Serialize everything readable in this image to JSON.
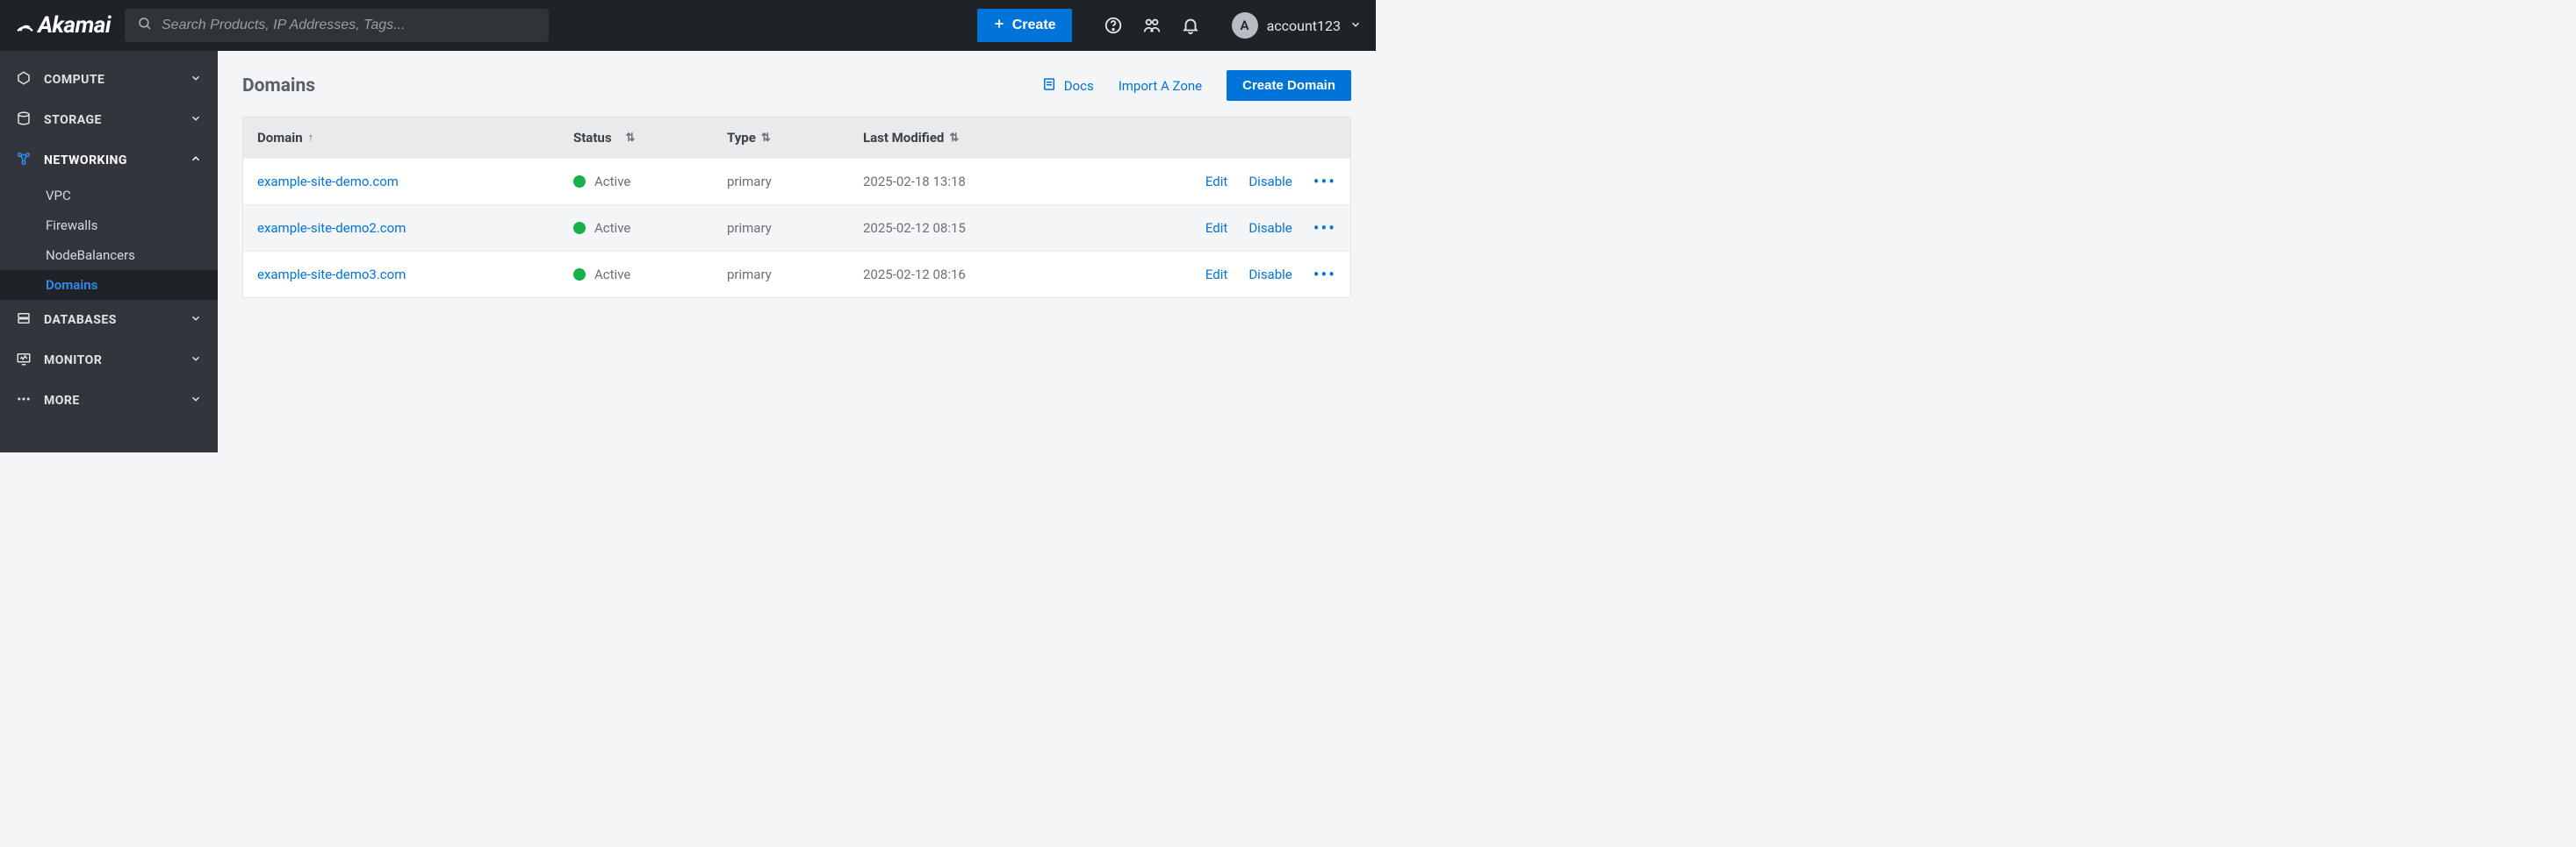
{
  "header": {
    "brand": "Akamai",
    "search_placeholder": "Search Products, IP Addresses, Tags...",
    "create_label": "Create",
    "account_name": "account123",
    "avatar_letter": "A"
  },
  "sidebar": {
    "groups": [
      {
        "label": "COMPUTE",
        "expanded": false
      },
      {
        "label": "STORAGE",
        "expanded": false
      },
      {
        "label": "NETWORKING",
        "expanded": true,
        "items": [
          {
            "label": "VPC",
            "selected": false
          },
          {
            "label": "Firewalls",
            "selected": false
          },
          {
            "label": "NodeBalancers",
            "selected": false
          },
          {
            "label": "Domains",
            "selected": true
          }
        ]
      },
      {
        "label": "DATABASES",
        "expanded": false
      },
      {
        "label": "MONITOR",
        "expanded": false
      },
      {
        "label": "MORE",
        "expanded": false
      }
    ]
  },
  "page": {
    "title": "Domains",
    "docs_label": "Docs",
    "import_label": "Import A Zone",
    "create_domain_label": "Create Domain"
  },
  "table": {
    "headers": {
      "domain": "Domain",
      "status": "Status",
      "type": "Type",
      "modified": "Last Modified"
    },
    "row_actions": {
      "edit": "Edit",
      "disable": "Disable"
    },
    "rows": [
      {
        "domain": "example-site-demo.com",
        "status": "Active",
        "type": "primary",
        "modified": "2025-02-18 13:18"
      },
      {
        "domain": "example-site-demo2.com",
        "status": "Active",
        "type": "primary",
        "modified": "2025-02-12 08:15"
      },
      {
        "domain": "example-site-demo3.com",
        "status": "Active",
        "type": "primary",
        "modified": "2025-02-12 08:16"
      }
    ]
  }
}
